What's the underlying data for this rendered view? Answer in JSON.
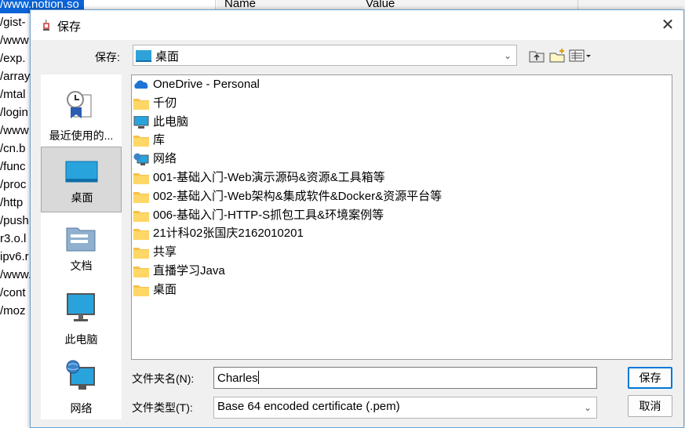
{
  "background": {
    "rows": [
      "/www.notion.so",
      "/gist-",
      "/www",
      "/exp.",
      "/array",
      "/mtal",
      "/login",
      "/www",
      "/cn.b",
      "/func",
      "/proc",
      "/http",
      "/push",
      "r3.o.l",
      "ipv6.r",
      "/www.",
      "/cont",
      "/moz"
    ],
    "header": {
      "name": "Name",
      "value": "Value"
    }
  },
  "dialog": {
    "title": "保存",
    "save_in_label": "保存:",
    "save_in_value": "桌面",
    "places": [
      {
        "label": "最近使用的...",
        "icon": "recent-icon"
      },
      {
        "label": "桌面",
        "icon": "desktop-icon",
        "selected": true
      },
      {
        "label": "文档",
        "icon": "documents-icon"
      },
      {
        "label": "此电脑",
        "icon": "computer-icon"
      },
      {
        "label": "网络",
        "icon": "network-icon"
      }
    ],
    "files": [
      {
        "name": "OneDrive - Personal",
        "icon": "onedrive-icon"
      },
      {
        "name": "千仞",
        "icon": "folder-icon"
      },
      {
        "name": "此电脑",
        "icon": "computer-icon"
      },
      {
        "name": "库",
        "icon": "folder-icon"
      },
      {
        "name": "网络",
        "icon": "network-icon"
      },
      {
        "name": "001-基础入门-Web演示源码&资源&工具箱等",
        "icon": "folder-icon"
      },
      {
        "name": "002-基础入门-Web架构&集成软件&Docker&资源平台等",
        "icon": "folder-icon"
      },
      {
        "name": "006-基础入门-HTTP-S抓包工具&环境案例等",
        "icon": "folder-icon"
      },
      {
        "name": "21计科02张国庆2162010201",
        "icon": "folder-icon"
      },
      {
        "name": "共享",
        "icon": "folder-icon"
      },
      {
        "name": "直播学习Java",
        "icon": "folder-icon"
      },
      {
        "name": "桌面",
        "icon": "folder-icon"
      }
    ],
    "filename_label": "文件夹名(N):",
    "filename_value": "Charles",
    "filetype_label": "文件类型(T):",
    "filetype_value": "Base 64 encoded certificate (.pem)",
    "save_button": "保存",
    "cancel_button": "取消",
    "close_glyph": "✕"
  }
}
